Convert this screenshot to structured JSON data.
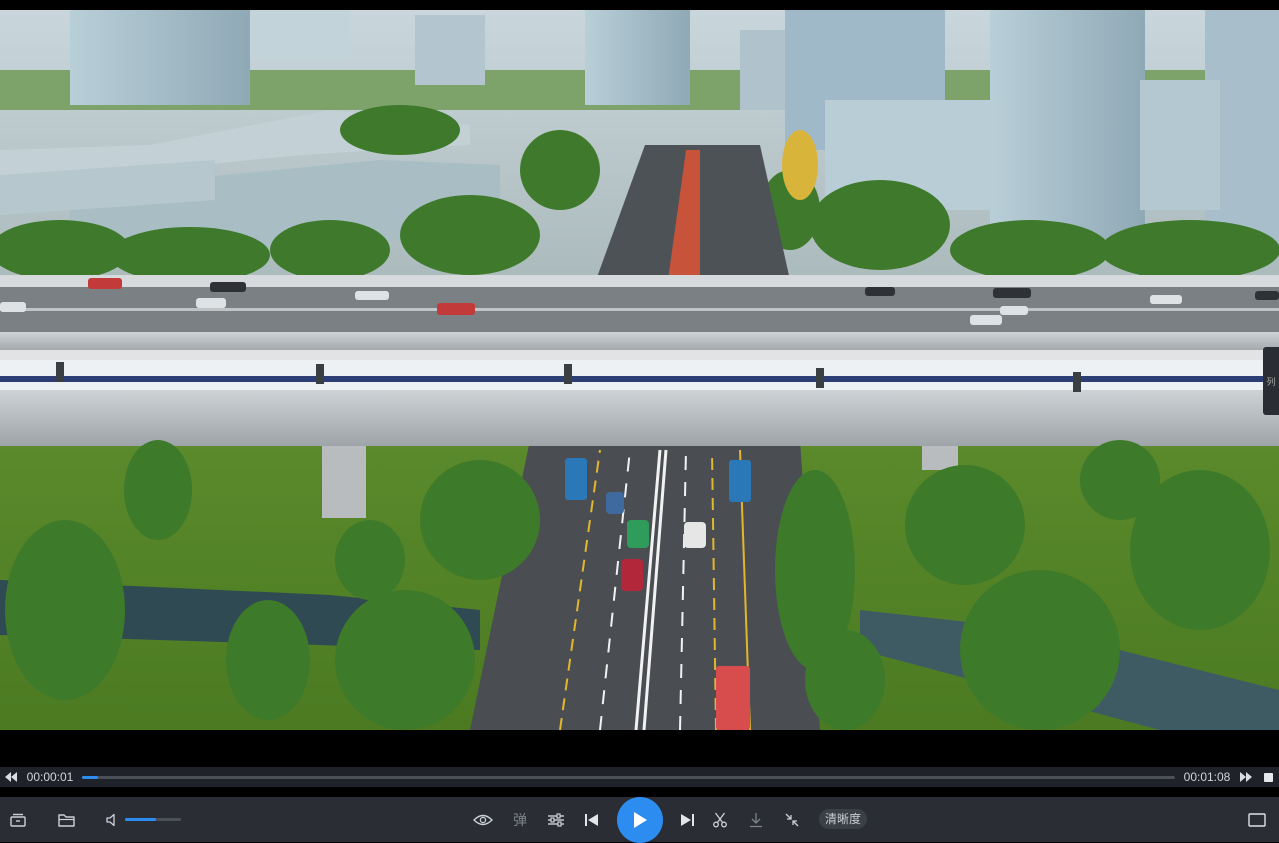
{
  "player": {
    "current_time": "00:00:01",
    "total_time": "00:01:08",
    "progress": 0.0147,
    "volume": 0.55,
    "danmaku_label": "弹",
    "quality_label": "清晰度",
    "side_handle_label": "列"
  },
  "colors": {
    "accent": "#2d8cf0",
    "bar_bg": "#2a2d33",
    "track": "#4b4f57"
  },
  "icons": {
    "rewind": "rewind-icon",
    "fast_forward": "fast-forward-icon",
    "stop": "stop-icon",
    "library": "library-icon",
    "open_folder": "folder-icon",
    "volume": "volume-icon",
    "eye_protect": "eye-icon",
    "settings": "equalizer-icon",
    "previous": "previous-icon",
    "play": "play-icon",
    "next": "next-icon",
    "cut": "scissors-icon",
    "download": "download-icon",
    "shrink": "shrink-icon",
    "fullscreen": "fullscreen-icon"
  }
}
